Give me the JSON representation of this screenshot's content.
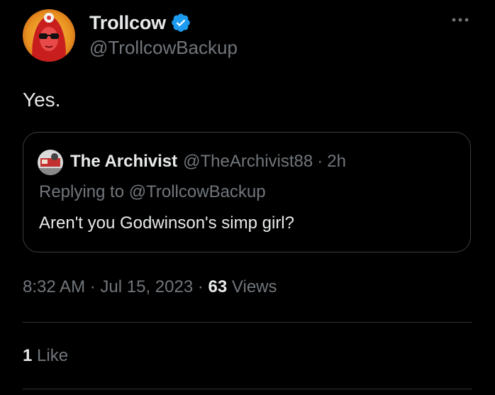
{
  "tweet": {
    "author": {
      "display_name": "Trollcow",
      "handle": "@TrollcowBackup",
      "verified": true
    },
    "text": "Yes.",
    "quoted": {
      "display_name": "The Archivist",
      "handle": "@TheArchivist88",
      "separator": "·",
      "time": "2h",
      "replying_prefix": "Replying to",
      "replying_to": "@TrollcowBackup",
      "text": "Aren't you Godwinson's simp girl?"
    },
    "meta": {
      "time": "8:32 AM",
      "separator": "·",
      "date": "Jul 15, 2023",
      "views_count": "63",
      "views_label": "Views"
    },
    "stats": {
      "likes_count": "1",
      "likes_label": "Like"
    }
  },
  "icons": {
    "verified": "verified-badge-icon",
    "more": "more-options-icon"
  },
  "colors": {
    "background": "#000000",
    "text_primary": "#e7e9ea",
    "text_secondary": "#71767b",
    "verified_blue": "#1d9bf0",
    "border": "#2f3336"
  }
}
